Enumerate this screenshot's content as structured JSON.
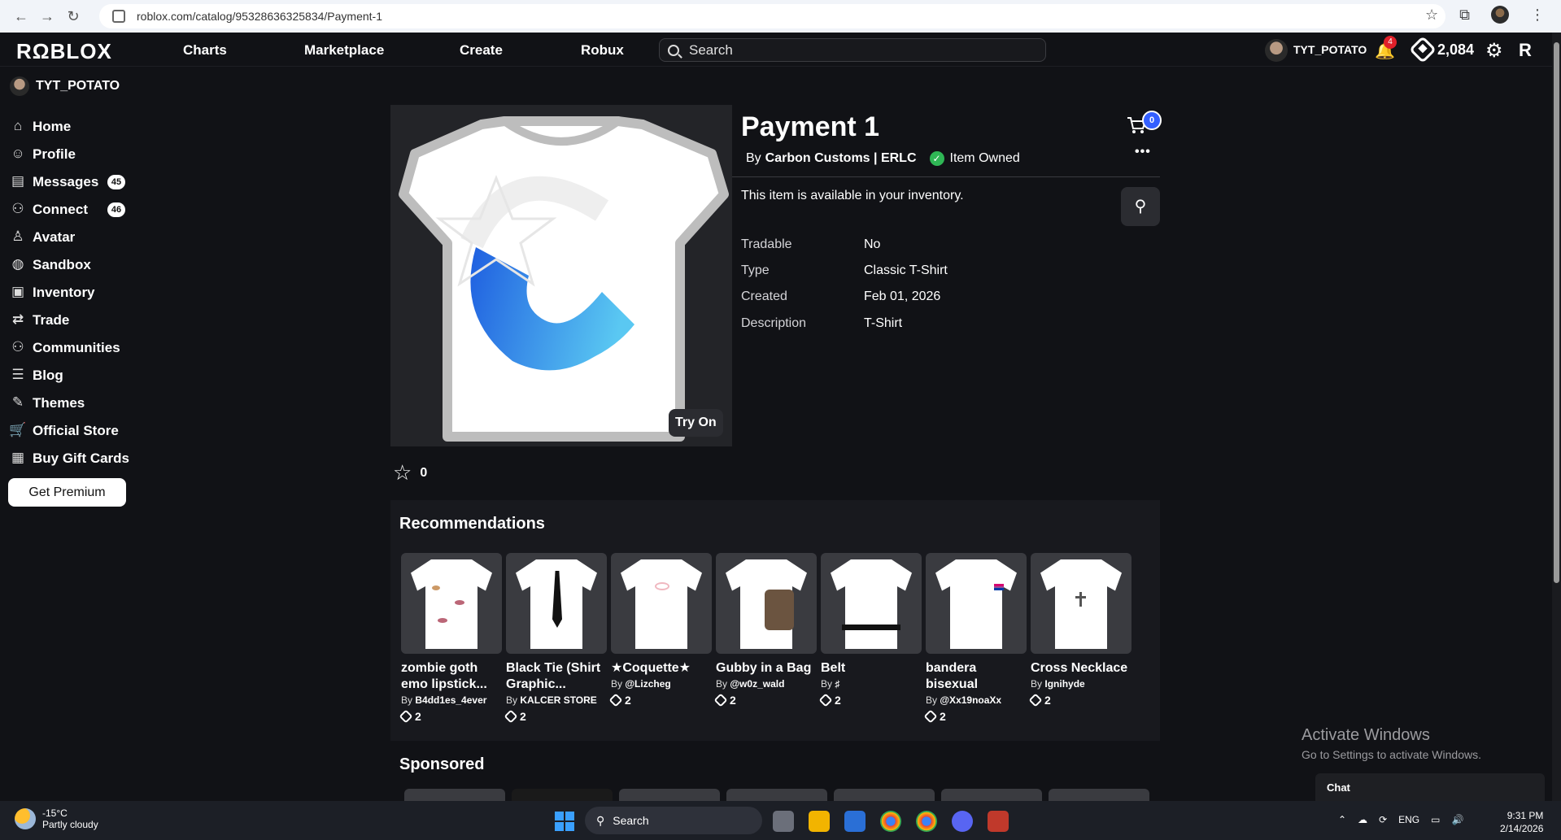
{
  "browser": {
    "url": "roblox.com/catalog/95328636325834/Payment-1"
  },
  "topbar": {
    "logo": "RΩBLOX",
    "nav": [
      "Charts",
      "Marketplace",
      "Create",
      "Robux"
    ],
    "search_placeholder": "Search",
    "username": "TYT_POTATO",
    "notifications": "4",
    "robux": "2,084"
  },
  "sidebar": {
    "username": "TYT_POTATO",
    "items": [
      {
        "label": "Home",
        "icon": "home-icon"
      },
      {
        "label": "Profile",
        "icon": "profile-icon"
      },
      {
        "label": "Messages",
        "icon": "messages-icon",
        "badge": "45"
      },
      {
        "label": "Connect",
        "icon": "connect-icon",
        "badge": "46"
      },
      {
        "label": "Avatar",
        "icon": "avatar-icon"
      },
      {
        "label": "Sandbox",
        "icon": "sandbox-icon"
      },
      {
        "label": "Inventory",
        "icon": "inventory-icon"
      },
      {
        "label": "Trade",
        "icon": "trade-icon"
      },
      {
        "label": "Communities",
        "icon": "communities-icon"
      },
      {
        "label": "Blog",
        "icon": "blog-icon"
      },
      {
        "label": "Themes",
        "icon": "themes-icon"
      },
      {
        "label": "Official Store",
        "icon": "cart-icon"
      },
      {
        "label": "Buy Gift Cards",
        "icon": "gift-card-icon"
      }
    ],
    "premium_button": "Get Premium"
  },
  "item": {
    "title": "Payment 1",
    "by_prefix": "By",
    "creator": "Carbon Customs | ERLC",
    "owned": "Item Owned",
    "cart_count": "0",
    "try_on": "Try On",
    "availability": "This item is available in your inventory.",
    "details": [
      {
        "key": "Tradable",
        "value": "No"
      },
      {
        "key": "Type",
        "value": "Classic T-Shirt"
      },
      {
        "key": "Created",
        "value": "Feb 01, 2026"
      },
      {
        "key": "Description",
        "value": "T-Shirt"
      }
    ],
    "favorites": "0"
  },
  "recommendations": {
    "title": "Recommendations",
    "items": [
      {
        "name": "zombie goth emo lipstick...",
        "by": "By",
        "creator": "B4dd1es_4ever",
        "price": "2"
      },
      {
        "name": "Black Tie (Shirt Graphic...",
        "by": "By",
        "creator": "KALCER STORE",
        "price": "2"
      },
      {
        "name": "★Coquette★",
        "by": "By",
        "creator": "@Lizcheg",
        "price": "2"
      },
      {
        "name": "Gubby in a Bag",
        "by": "By",
        "creator": "@w0z_wald",
        "price": "2"
      },
      {
        "name": "Belt",
        "by": "By",
        "creator": "♯",
        "price": "2"
      },
      {
        "name": "bandera bisexual",
        "by": "By",
        "creator": "@Xx19noaXx",
        "price": "2"
      },
      {
        "name": "Cross Necklace",
        "by": "By",
        "creator": "Ignihyde",
        "price": "2"
      }
    ]
  },
  "sponsored": {
    "title": "Sponsored"
  },
  "overlay": {
    "activate_title": "Activate Windows",
    "activate_sub": "Go to Settings to activate Windows.",
    "chat": "Chat"
  },
  "taskbar": {
    "temp": "-15°C",
    "weather": "Partly cloudy",
    "search": "Search",
    "lang": "ENG",
    "time": "9:31 PM",
    "date": "2/14/2026"
  },
  "colors": {
    "background": "#111216",
    "accent_blue": "#335fff",
    "owned_green": "#2fb655",
    "badge_red": "#e0202a"
  }
}
